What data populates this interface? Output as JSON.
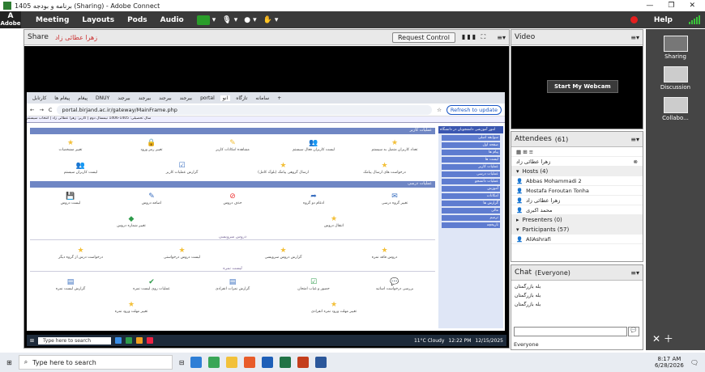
{
  "window": {
    "title": "برنامه و بودجه 1405 (Sharing) - Adobe Connect",
    "minimize": "—",
    "maximize": "❐",
    "close": "✕"
  },
  "menubar": {
    "logo_top": "Adobe",
    "items": [
      "Meeting",
      "Layouts",
      "Pods",
      "Audio"
    ],
    "help": "Help"
  },
  "share": {
    "title": "Share",
    "presenter": "زهرا عطائی زاد",
    "request_control": "Request Control",
    "menu_icon": "≡▾"
  },
  "browser": {
    "tabs": [
      "کارتابل",
      "پیغام ها",
      "پیغام",
      "DNUY",
      "بیرجند",
      "بیرجند",
      "بیرجند",
      "بیرجند",
      "portal",
      "انو",
      "تازگاه",
      "سامانه",
      "+"
    ],
    "url": "portal.birjand.ac.ir/gateway/MainFrame.php",
    "refresh_btn": "Refresh to update",
    "top_strip": "سال تحصیلی: 1405-1406 نیمسال دوم | کاربر: زهرا عطائی زاد | انتخاب سیستم"
  },
  "portal": {
    "section1": "عملیات کاربر",
    "row1": [
      "تغییر مشخصات",
      "تغییر رمز ورود",
      "مشاهده امکانات کاربر",
      "لیست کاربران فعال سیستم",
      "تعداد کاربران متصل به سیستم"
    ],
    "row2": [
      "لیست کاربران سیستم",
      "گزارش عملیات کاربر",
      "ارسال گروهی پیامک (بلوک کامل)",
      "درخواست های ارسال پیامک"
    ],
    "section2": "عملیات درسی",
    "row3": [
      "لیست دروس",
      "اضافه دروس",
      "حذف دروس",
      "ادغام دو گروه",
      "تغییر گروه درسی"
    ],
    "row4": [
      "تغییر شماره دروس",
      "انتقال دروس"
    ],
    "sub1": "دروس سرویسی",
    "row5": [
      "درخواست درس از گروه دیگر",
      "لیست دروس درخواستی",
      "گزارش دروس سرویسی",
      "دروس فاقد نمره"
    ],
    "sub2": "لیست نمره",
    "row6": [
      "گزارش لیست نمره",
      "عملیات روی لیست نمره",
      "گزارش نمرات انفرادی",
      "حضور و غیاب امتحان",
      "بررسی درخواست اساتید"
    ],
    "row7": [
      "تغییر مهلت ورود نمره",
      "تغییر مهلت ورود نمره انفرادی"
    ],
    "side_title": "امور آموزشی دانشجویان در دانشگاه",
    "side_items": [
      "سوابقه اصلی",
      "صفحه اول",
      "پیام ها",
      "لیست ها",
      "عملیات کاربر",
      "عملیات درسی",
      "عملیات دانشجو",
      "آموزش",
      "امکانات",
      "گزارش ها",
      "مالی",
      "ترمیم",
      "تاریخچه"
    ]
  },
  "inner_taskbar": {
    "search": "Type here to search",
    "weather": "11°C Cloudy",
    "time": "12:22 PM",
    "date": "12/15/2025"
  },
  "video": {
    "title": "Video",
    "webcam_btn": "Start My Webcam"
  },
  "attendees": {
    "title": "Attendees",
    "count": "(61)",
    "hosts": "Hosts (4)",
    "host_list": [
      "زهرا عطائی زاد",
      "Abbas Mohammadi 2",
      "Mostafa Foroutan Tonha",
      "زهرا عطائی زاد",
      "محمد اکبری"
    ],
    "presenters": "Presenters (0)",
    "participants": "Participants (57)",
    "participant_list": [
      "AliAshrafi"
    ]
  },
  "chat": {
    "title": "Chat",
    "scope": "(Everyone)",
    "messages": [
      "بله بازرگمتان",
      "بله بازرگمتان",
      "بله بازرگمتان"
    ],
    "to": "Everyone"
  },
  "layouts": {
    "items": [
      "Sharing",
      "Discussion",
      "Collabo..."
    ]
  },
  "taskbar": {
    "search": "Type here to search",
    "time": "8:17 AM",
    "date": "6/28/2026"
  }
}
